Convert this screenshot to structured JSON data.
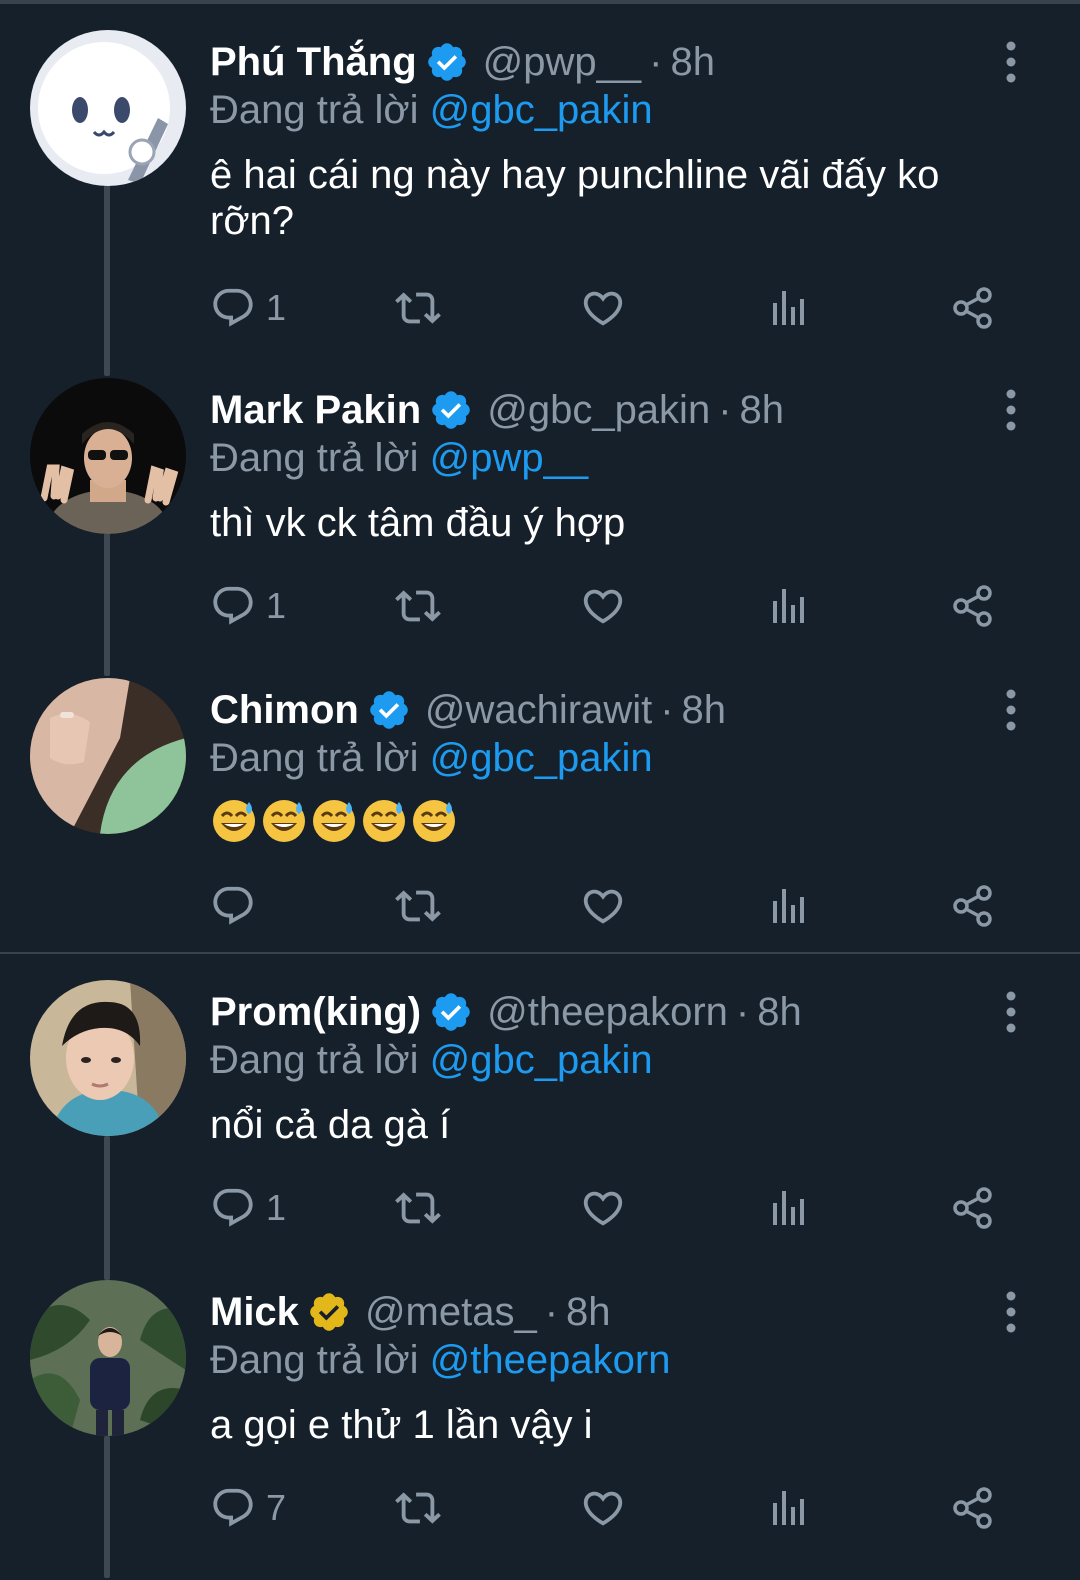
{
  "colors": {
    "background": "#15202b",
    "text": "#ffffff",
    "secondary_text": "#8b98a5",
    "link": "#1d9bf0",
    "verified_blue": "#1d9bf0",
    "verified_gold": "#e2b719",
    "divider": "#38444d"
  },
  "reply_prefix": "Đang trả lời",
  "tweets": [
    {
      "name": "Phú Thắng",
      "verified": "blue",
      "handle": "@pwp__",
      "separator": "·",
      "time": "8h",
      "replying_to": "@gbc_pakin",
      "text": "ê hai cái ng này hay punchline vãi đấy ko rỡn?",
      "reply_count": "1",
      "avatar": "cartoon-white-character-avatar"
    },
    {
      "name": "Mark Pakin",
      "verified": "blue",
      "handle": "@gbc_pakin",
      "separator": "·",
      "time": "8h",
      "replying_to": "@pwp__",
      "text": "thì vk ck tâm đầu ý hợp",
      "reply_count": "1",
      "avatar": "man-sunglasses-peace-sign-avatar"
    },
    {
      "name": "Chimon",
      "verified": "blue",
      "handle": "@wachirawit",
      "separator": "·",
      "time": "8h",
      "replying_to": "@gbc_pakin",
      "text": "😅😅😅😅😅",
      "reply_count": "",
      "avatar": "hand-close-up-avatar"
    },
    {
      "name": "Prom(king)",
      "verified": "blue",
      "handle": "@theepakorn",
      "separator": "·",
      "time": "8h",
      "replying_to": "@gbc_pakin",
      "text": "nổi cả da gà í",
      "reply_count": "1",
      "avatar": "young-man-selfie-avatar"
    },
    {
      "name": "Mick",
      "verified": "gold",
      "handle": "@metas_",
      "separator": "·",
      "time": "8h",
      "replying_to": "@theepakorn",
      "text": "a gọi e thử 1 lần vậy i",
      "reply_count": "7",
      "avatar": "man-in-garden-avatar"
    }
  ],
  "icons": [
    "reply-icon",
    "retweet-icon",
    "like-icon",
    "views-icon",
    "share-icon",
    "more-icon",
    "verified-badge-icon"
  ]
}
